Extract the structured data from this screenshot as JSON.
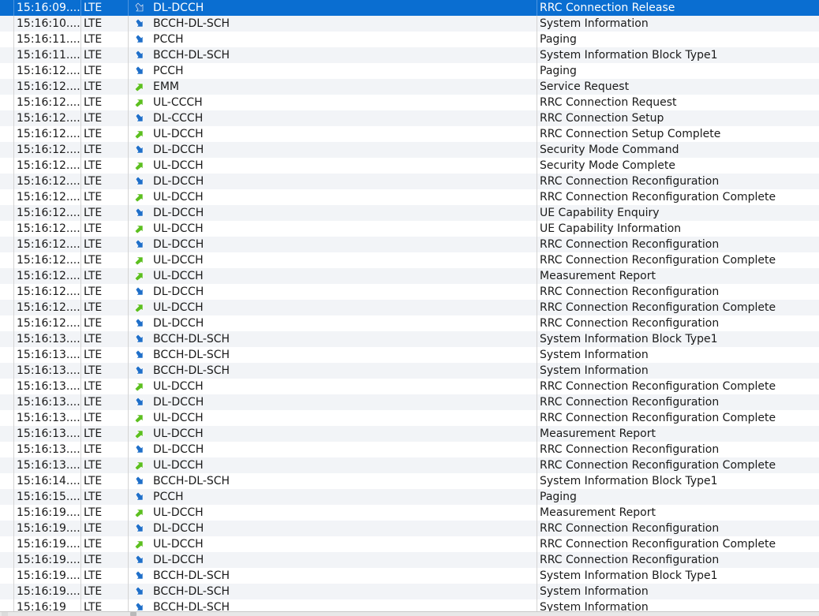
{
  "colors": {
    "selection": "#0a6ed1",
    "downlink_icon": "#1f6fc9",
    "uplink_icon": "#5cbf1f"
  },
  "icons": {
    "down": "downlink-arrow-icon",
    "up": "uplink-arrow-icon"
  },
  "log": {
    "selected_index": 0,
    "rows": [
      {
        "time": "15:16:09....",
        "tech": "LTE",
        "dir": "down",
        "channel": "DL-DCCH",
        "message": "RRC Connection Release"
      },
      {
        "time": "15:16:10....",
        "tech": "LTE",
        "dir": "down",
        "channel": "BCCH-DL-SCH",
        "message": "System Information"
      },
      {
        "time": "15:16:11....",
        "tech": "LTE",
        "dir": "down",
        "channel": "PCCH",
        "message": "Paging"
      },
      {
        "time": "15:16:11....",
        "tech": "LTE",
        "dir": "down",
        "channel": "BCCH-DL-SCH",
        "message": "System Information Block Type1"
      },
      {
        "time": "15:16:12....",
        "tech": "LTE",
        "dir": "down",
        "channel": "PCCH",
        "message": "Paging"
      },
      {
        "time": "15:16:12....",
        "tech": "LTE",
        "dir": "up",
        "channel": "EMM",
        "message": "Service Request"
      },
      {
        "time": "15:16:12....",
        "tech": "LTE",
        "dir": "up",
        "channel": "UL-CCCH",
        "message": "RRC Connection Request"
      },
      {
        "time": "15:16:12....",
        "tech": "LTE",
        "dir": "down",
        "channel": "DL-CCCH",
        "message": "RRC Connection Setup"
      },
      {
        "time": "15:16:12....",
        "tech": "LTE",
        "dir": "up",
        "channel": "UL-DCCH",
        "message": "RRC Connection Setup Complete"
      },
      {
        "time": "15:16:12....",
        "tech": "LTE",
        "dir": "down",
        "channel": "DL-DCCH",
        "message": "Security Mode Command"
      },
      {
        "time": "15:16:12....",
        "tech": "LTE",
        "dir": "up",
        "channel": "UL-DCCH",
        "message": "Security Mode Complete"
      },
      {
        "time": "15:16:12....",
        "tech": "LTE",
        "dir": "down",
        "channel": "DL-DCCH",
        "message": "RRC Connection Reconfiguration"
      },
      {
        "time": "15:16:12....",
        "tech": "LTE",
        "dir": "up",
        "channel": "UL-DCCH",
        "message": "RRC Connection Reconfiguration Complete"
      },
      {
        "time": "15:16:12....",
        "tech": "LTE",
        "dir": "down",
        "channel": "DL-DCCH",
        "message": "UE Capability Enquiry"
      },
      {
        "time": "15:16:12....",
        "tech": "LTE",
        "dir": "up",
        "channel": "UL-DCCH",
        "message": "UE Capability Information"
      },
      {
        "time": "15:16:12....",
        "tech": "LTE",
        "dir": "down",
        "channel": "DL-DCCH",
        "message": "RRC Connection Reconfiguration"
      },
      {
        "time": "15:16:12....",
        "tech": "LTE",
        "dir": "up",
        "channel": "UL-DCCH",
        "message": "RRC Connection Reconfiguration Complete"
      },
      {
        "time": "15:16:12....",
        "tech": "LTE",
        "dir": "up",
        "channel": "UL-DCCH",
        "message": "Measurement Report"
      },
      {
        "time": "15:16:12....",
        "tech": "LTE",
        "dir": "down",
        "channel": "DL-DCCH",
        "message": "RRC Connection Reconfiguration"
      },
      {
        "time": "15:16:12....",
        "tech": "LTE",
        "dir": "up",
        "channel": "UL-DCCH",
        "message": "RRC Connection Reconfiguration Complete"
      },
      {
        "time": "15:16:12....",
        "tech": "LTE",
        "dir": "down",
        "channel": "DL-DCCH",
        "message": "RRC Connection Reconfiguration"
      },
      {
        "time": "15:16:13....",
        "tech": "LTE",
        "dir": "down",
        "channel": "BCCH-DL-SCH",
        "message": "System Information Block Type1"
      },
      {
        "time": "15:16:13....",
        "tech": "LTE",
        "dir": "down",
        "channel": "BCCH-DL-SCH",
        "message": "System Information"
      },
      {
        "time": "15:16:13....",
        "tech": "LTE",
        "dir": "down",
        "channel": "BCCH-DL-SCH",
        "message": "System Information"
      },
      {
        "time": "15:16:13....",
        "tech": "LTE",
        "dir": "up",
        "channel": "UL-DCCH",
        "message": "RRC Connection Reconfiguration Complete"
      },
      {
        "time": "15:16:13....",
        "tech": "LTE",
        "dir": "down",
        "channel": "DL-DCCH",
        "message": "RRC Connection Reconfiguration"
      },
      {
        "time": "15:16:13....",
        "tech": "LTE",
        "dir": "up",
        "channel": "UL-DCCH",
        "message": "RRC Connection Reconfiguration Complete"
      },
      {
        "time": "15:16:13....",
        "tech": "LTE",
        "dir": "up",
        "channel": "UL-DCCH",
        "message": "Measurement Report"
      },
      {
        "time": "15:16:13....",
        "tech": "LTE",
        "dir": "down",
        "channel": "DL-DCCH",
        "message": "RRC Connection Reconfiguration"
      },
      {
        "time": "15:16:13....",
        "tech": "LTE",
        "dir": "up",
        "channel": "UL-DCCH",
        "message": "RRC Connection Reconfiguration Complete"
      },
      {
        "time": "15:16:14....",
        "tech": "LTE",
        "dir": "down",
        "channel": "BCCH-DL-SCH",
        "message": "System Information Block Type1"
      },
      {
        "time": "15:16:15....",
        "tech": "LTE",
        "dir": "down",
        "channel": "PCCH",
        "message": "Paging"
      },
      {
        "time": "15:16:19....",
        "tech": "LTE",
        "dir": "up",
        "channel": "UL-DCCH",
        "message": "Measurement Report"
      },
      {
        "time": "15:16:19....",
        "tech": "LTE",
        "dir": "down",
        "channel": "DL-DCCH",
        "message": "RRC Connection Reconfiguration"
      },
      {
        "time": "15:16:19....",
        "tech": "LTE",
        "dir": "up",
        "channel": "UL-DCCH",
        "message": "RRC Connection Reconfiguration Complete"
      },
      {
        "time": "15:16:19....",
        "tech": "LTE",
        "dir": "down",
        "channel": "DL-DCCH",
        "message": "RRC Connection Reconfiguration"
      },
      {
        "time": "15:16:19....",
        "tech": "LTE",
        "dir": "down",
        "channel": "BCCH-DL-SCH",
        "message": "System Information Block Type1"
      },
      {
        "time": "15:16:19....",
        "tech": "LTE",
        "dir": "down",
        "channel": "BCCH-DL-SCH",
        "message": "System Information"
      },
      {
        "time": "15:16:19",
        "tech": "LTE",
        "dir": "down",
        "channel": "BCCH-DL-SCH",
        "message": "System Information"
      }
    ]
  }
}
